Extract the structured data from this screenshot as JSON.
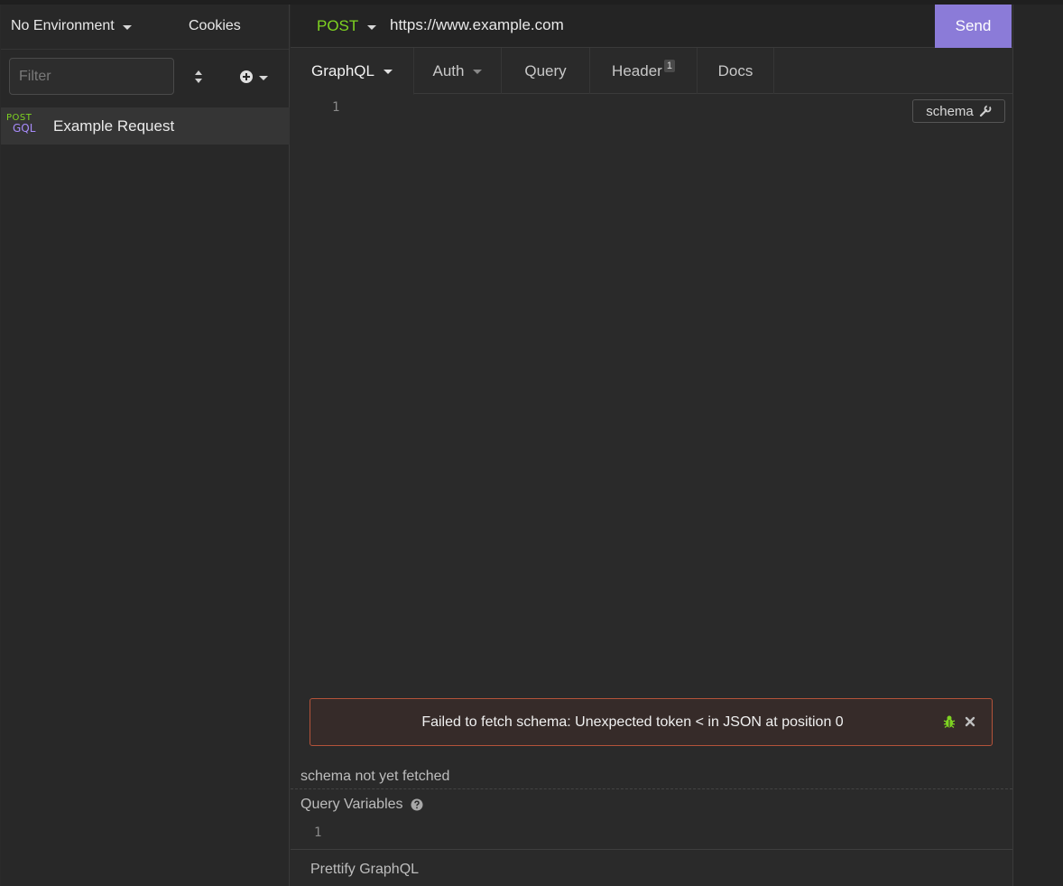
{
  "sidebar": {
    "environment": "No Environment",
    "cookies": "Cookies",
    "filter_placeholder": "Filter",
    "requests": [
      {
        "method_top": "POST",
        "method_bottom": "GQL",
        "name": "Example Request"
      }
    ]
  },
  "urlbar": {
    "method": "POST",
    "url": "https://www.example.com",
    "send": "Send"
  },
  "tabs": {
    "body": "GraphQL",
    "auth": "Auth",
    "query": "Query",
    "header": "Header",
    "header_count": "1",
    "docs": "Docs"
  },
  "editor": {
    "line1": "1",
    "schema_button": "schema",
    "error": "Failed to fetch schema: Unexpected token < in JSON at position 0",
    "schema_status": "schema not yet fetched",
    "query_variables": "Query Variables",
    "variables_line1": "1",
    "prettify": "Prettify GraphQL"
  },
  "colors": {
    "accent": "#8b7bd8",
    "method_post": "#7ed321",
    "gql": "#a78bfa",
    "error_border": "#b4533a"
  }
}
